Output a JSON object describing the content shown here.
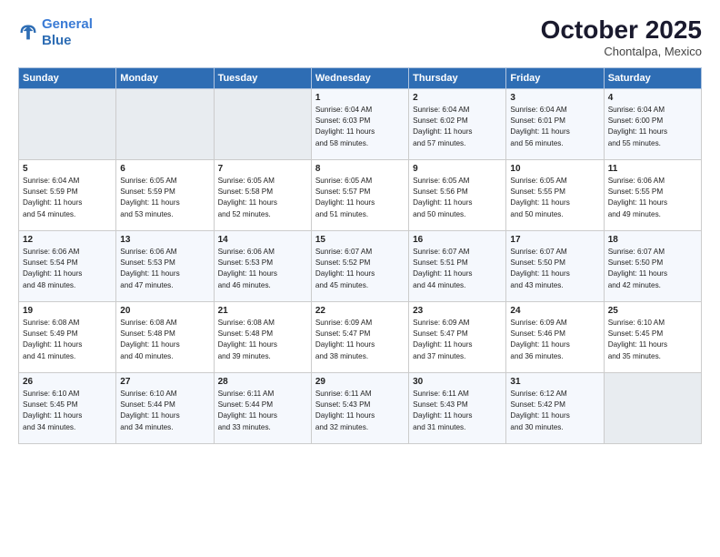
{
  "header": {
    "logo_line1": "General",
    "logo_line2": "Blue",
    "month": "October 2025",
    "location": "Chontalpa, Mexico"
  },
  "weekdays": [
    "Sunday",
    "Monday",
    "Tuesday",
    "Wednesday",
    "Thursday",
    "Friday",
    "Saturday"
  ],
  "weeks": [
    [
      {
        "day": "",
        "info": ""
      },
      {
        "day": "",
        "info": ""
      },
      {
        "day": "",
        "info": ""
      },
      {
        "day": "1",
        "info": "Sunrise: 6:04 AM\nSunset: 6:03 PM\nDaylight: 11 hours\nand 58 minutes."
      },
      {
        "day": "2",
        "info": "Sunrise: 6:04 AM\nSunset: 6:02 PM\nDaylight: 11 hours\nand 57 minutes."
      },
      {
        "day": "3",
        "info": "Sunrise: 6:04 AM\nSunset: 6:01 PM\nDaylight: 11 hours\nand 56 minutes."
      },
      {
        "day": "4",
        "info": "Sunrise: 6:04 AM\nSunset: 6:00 PM\nDaylight: 11 hours\nand 55 minutes."
      }
    ],
    [
      {
        "day": "5",
        "info": "Sunrise: 6:04 AM\nSunset: 5:59 PM\nDaylight: 11 hours\nand 54 minutes."
      },
      {
        "day": "6",
        "info": "Sunrise: 6:05 AM\nSunset: 5:59 PM\nDaylight: 11 hours\nand 53 minutes."
      },
      {
        "day": "7",
        "info": "Sunrise: 6:05 AM\nSunset: 5:58 PM\nDaylight: 11 hours\nand 52 minutes."
      },
      {
        "day": "8",
        "info": "Sunrise: 6:05 AM\nSunset: 5:57 PM\nDaylight: 11 hours\nand 51 minutes."
      },
      {
        "day": "9",
        "info": "Sunrise: 6:05 AM\nSunset: 5:56 PM\nDaylight: 11 hours\nand 50 minutes."
      },
      {
        "day": "10",
        "info": "Sunrise: 6:05 AM\nSunset: 5:55 PM\nDaylight: 11 hours\nand 50 minutes."
      },
      {
        "day": "11",
        "info": "Sunrise: 6:06 AM\nSunset: 5:55 PM\nDaylight: 11 hours\nand 49 minutes."
      }
    ],
    [
      {
        "day": "12",
        "info": "Sunrise: 6:06 AM\nSunset: 5:54 PM\nDaylight: 11 hours\nand 48 minutes."
      },
      {
        "day": "13",
        "info": "Sunrise: 6:06 AM\nSunset: 5:53 PM\nDaylight: 11 hours\nand 47 minutes."
      },
      {
        "day": "14",
        "info": "Sunrise: 6:06 AM\nSunset: 5:53 PM\nDaylight: 11 hours\nand 46 minutes."
      },
      {
        "day": "15",
        "info": "Sunrise: 6:07 AM\nSunset: 5:52 PM\nDaylight: 11 hours\nand 45 minutes."
      },
      {
        "day": "16",
        "info": "Sunrise: 6:07 AM\nSunset: 5:51 PM\nDaylight: 11 hours\nand 44 minutes."
      },
      {
        "day": "17",
        "info": "Sunrise: 6:07 AM\nSunset: 5:50 PM\nDaylight: 11 hours\nand 43 minutes."
      },
      {
        "day": "18",
        "info": "Sunrise: 6:07 AM\nSunset: 5:50 PM\nDaylight: 11 hours\nand 42 minutes."
      }
    ],
    [
      {
        "day": "19",
        "info": "Sunrise: 6:08 AM\nSunset: 5:49 PM\nDaylight: 11 hours\nand 41 minutes."
      },
      {
        "day": "20",
        "info": "Sunrise: 6:08 AM\nSunset: 5:48 PM\nDaylight: 11 hours\nand 40 minutes."
      },
      {
        "day": "21",
        "info": "Sunrise: 6:08 AM\nSunset: 5:48 PM\nDaylight: 11 hours\nand 39 minutes."
      },
      {
        "day": "22",
        "info": "Sunrise: 6:09 AM\nSunset: 5:47 PM\nDaylight: 11 hours\nand 38 minutes."
      },
      {
        "day": "23",
        "info": "Sunrise: 6:09 AM\nSunset: 5:47 PM\nDaylight: 11 hours\nand 37 minutes."
      },
      {
        "day": "24",
        "info": "Sunrise: 6:09 AM\nSunset: 5:46 PM\nDaylight: 11 hours\nand 36 minutes."
      },
      {
        "day": "25",
        "info": "Sunrise: 6:10 AM\nSunset: 5:45 PM\nDaylight: 11 hours\nand 35 minutes."
      }
    ],
    [
      {
        "day": "26",
        "info": "Sunrise: 6:10 AM\nSunset: 5:45 PM\nDaylight: 11 hours\nand 34 minutes."
      },
      {
        "day": "27",
        "info": "Sunrise: 6:10 AM\nSunset: 5:44 PM\nDaylight: 11 hours\nand 34 minutes."
      },
      {
        "day": "28",
        "info": "Sunrise: 6:11 AM\nSunset: 5:44 PM\nDaylight: 11 hours\nand 33 minutes."
      },
      {
        "day": "29",
        "info": "Sunrise: 6:11 AM\nSunset: 5:43 PM\nDaylight: 11 hours\nand 32 minutes."
      },
      {
        "day": "30",
        "info": "Sunrise: 6:11 AM\nSunset: 5:43 PM\nDaylight: 11 hours\nand 31 minutes."
      },
      {
        "day": "31",
        "info": "Sunrise: 6:12 AM\nSunset: 5:42 PM\nDaylight: 11 hours\nand 30 minutes."
      },
      {
        "day": "",
        "info": ""
      }
    ]
  ]
}
